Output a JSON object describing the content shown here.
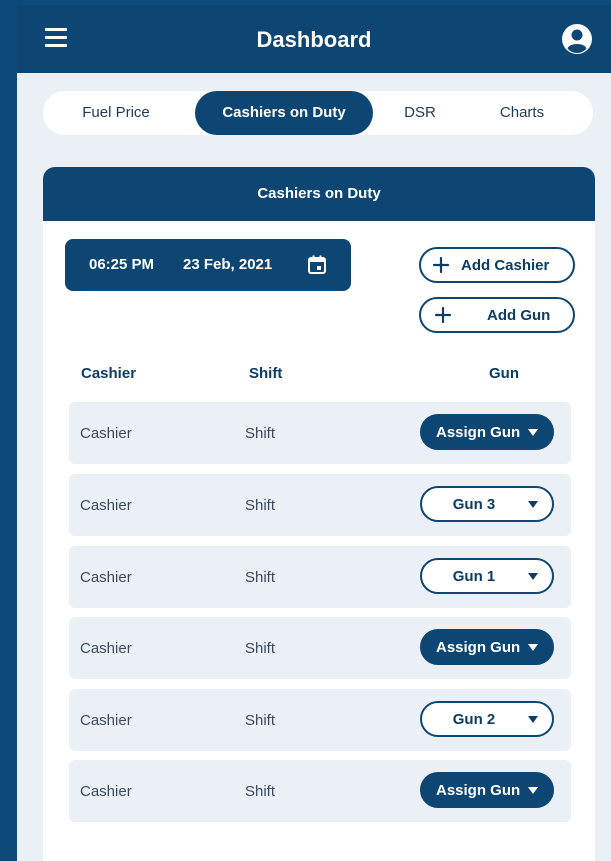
{
  "app": {
    "title": "Dashboard",
    "menu_icon": "hamburger-menu-icon",
    "profile_icon": "user-account-icon"
  },
  "tabs": [
    {
      "label": "Fuel Price",
      "active": false
    },
    {
      "label": "Cashiers on Duty",
      "active": true
    },
    {
      "label": "DSR",
      "active": false
    },
    {
      "label": "Charts",
      "active": false
    }
  ],
  "card": {
    "title": "Cashiers on Duty",
    "datetime": {
      "time": "06:25 PM",
      "date": "23 Feb, 2021",
      "icon": "calendar-icon"
    },
    "add_cashier_label": "Add Cashier",
    "add_gun_label": "Add Gun",
    "columns": {
      "cashier": "Cashier",
      "shift": "Shift",
      "gun": "Gun"
    },
    "rows": [
      {
        "cashier": "Cashier",
        "shift": "Shift",
        "gun": "Assign Gun",
        "assigned": false
      },
      {
        "cashier": "Cashier",
        "shift": "Shift",
        "gun": "Gun 3",
        "assigned": true
      },
      {
        "cashier": "Cashier",
        "shift": "Shift",
        "gun": "Gun 1",
        "assigned": true
      },
      {
        "cashier": "Cashier",
        "shift": "Shift",
        "gun": "Assign Gun",
        "assigned": false
      },
      {
        "cashier": "Cashier",
        "shift": "Shift",
        "gun": "Gun 2",
        "assigned": true
      },
      {
        "cashier": "Cashier",
        "shift": "Shift",
        "gun": "Assign Gun",
        "assigned": false
      }
    ]
  },
  "colors": {
    "primary": "#0d4673",
    "background": "#ebf0f6",
    "surface": "#ffffff",
    "outer": "#0d4a7a"
  }
}
